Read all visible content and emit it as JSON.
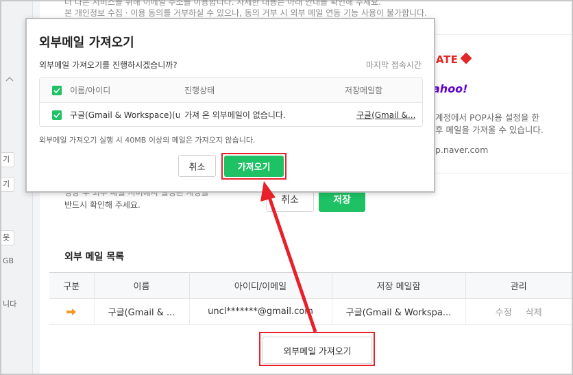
{
  "background": {
    "notice_top": "더 나은 서비스를 위해 이메일 주소를 이용합니다. 자세한 내용은 아래 안내를 확인해 주세요.",
    "notice": "본 개인정보 수집 · 이용 동의를 거부하실 수 있으나, 동의 거부 시 외부 메일 연동 기능 사용이 불가합니다.",
    "logo_hate": "ATE",
    "logo_yahoo": "ahoo!",
    "pop_line1": "계정에서 POP사용 설정을 한",
    "pop_line2": "후 메일을 가져올 수 있습니다.",
    "pop_host": "p.naver.com",
    "confirm_line1": "정상 후 외부 메일 서버에서 설정된 계정을",
    "confirm_line2": "반드시 확인해 주세요.",
    "cancel_label": "취소",
    "save_label": "저장"
  },
  "sidebar": {
    "btn1": "기",
    "btn2": "기",
    "btn3": "봇",
    "txt_gb": "GB",
    "txt_da": "니다"
  },
  "ext_mail": {
    "title": "외부 메일 목록",
    "headers": [
      "구분",
      "이름",
      "아이디/이메일",
      "저장 메일함",
      "관리"
    ],
    "row": {
      "name": "구글(Gmail & ...",
      "email": "uncl*******@gmail.com",
      "mailbox": "구글(Gmail & Workspa...",
      "edit": "수정",
      "delete": "삭제"
    },
    "fetch_label": "외부메일 가져오기"
  },
  "modal": {
    "title": "외부메일 가져오기",
    "question": "외부메일 가져오기를 진행하시겠습니까?",
    "last_access": "마지막 접속시간",
    "col_name": "이름/아이디",
    "col_status": "진행상태",
    "col_mailbox": "저장메일함",
    "row_name": "구글(Gmail & Workspace)(u...",
    "row_status": "가져 온 외부메일이 없습니다.",
    "row_mailbox": "구글(Gmail &...",
    "note": "외부메일 가져오기 실행 시 40MB 이상의 메일은 가져오지 않습니다.",
    "cancel_label": "취소",
    "confirm_label": "가져오기"
  },
  "colors": {
    "accent_green": "#1ec164",
    "highlight_red": "#e8202a"
  }
}
